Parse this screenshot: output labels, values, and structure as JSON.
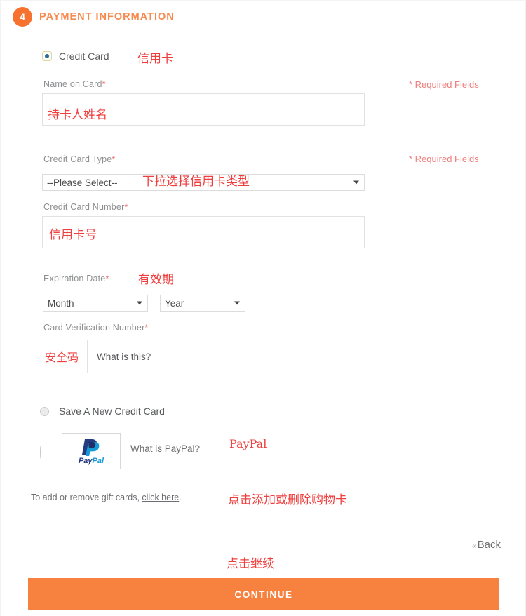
{
  "section": {
    "step_number": "4",
    "title": "PAYMENT INFORMATION"
  },
  "payment_methods": {
    "credit_card_label": "Credit Card",
    "save_new_card_label": "Save A New Credit Card",
    "paypal_logo_text": "PayPal",
    "paypal_help_link": "What is PayPal?"
  },
  "fields": {
    "name_on_card": {
      "label": "Name on Card",
      "required_marker": "*",
      "value": "",
      "placeholder": ""
    },
    "credit_card_type": {
      "label": "Credit Card Type",
      "required_marker": "*",
      "selected": "--Please Select--"
    },
    "credit_card_number": {
      "label": "Credit Card Number",
      "required_marker": "*",
      "value": "",
      "placeholder": ""
    },
    "expiration_date": {
      "label": "Expiration Date",
      "required_marker": "*",
      "month_selected": "Month",
      "year_selected": "Year"
    },
    "card_verification_number": {
      "label": "Card Verification Number",
      "required_marker": "*",
      "value": "",
      "help_link": "What is this?"
    }
  },
  "required_fields_note_1": "* Required Fields",
  "required_fields_note_2": "* Required Fields",
  "gift_cards": {
    "text_before": "To add or remove gift cards, ",
    "link": "click here",
    "text_after": "."
  },
  "footer": {
    "back_label": "Back",
    "back_chevron": "«",
    "continue_label": "CONTINUE"
  },
  "annotations": {
    "credit_card": "信用卡",
    "name_on_card": "持卡人姓名",
    "card_type": "下拉选择信用卡类型",
    "card_number": "信用卡号",
    "expiration": "有效期",
    "cvv": "安全码",
    "paypal": "PayPal",
    "gift_card": "点击添加或删除购物卡",
    "continue": "点击继续"
  },
  "colors": {
    "brand_orange": "#f7823f",
    "step_badge": "#f7712f",
    "title_orange": "#f7894d",
    "annotation_red": "#ef3e3e",
    "required_red": "#e8615f",
    "label_gray": "#8d8f91"
  }
}
